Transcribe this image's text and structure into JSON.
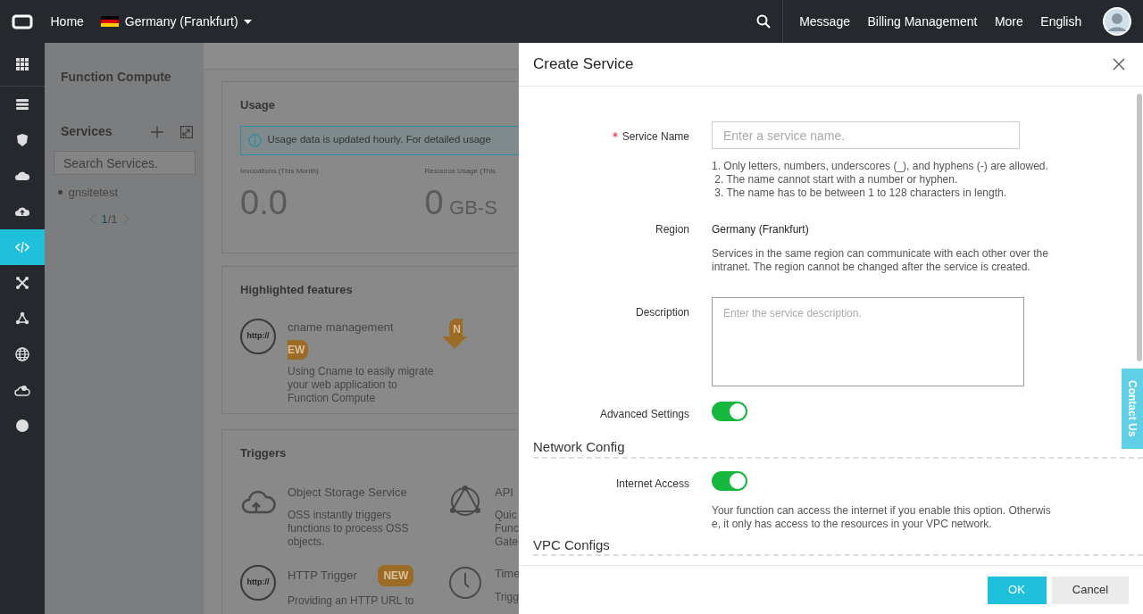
{
  "topbar": {
    "home": "Home",
    "region": "Germany (Frankfurt)",
    "links": [
      "Message",
      "Billing Management",
      "More",
      "English"
    ]
  },
  "rail": [
    {
      "selected": false
    },
    {
      "selected": false
    },
    {
      "selected": false
    },
    {
      "selected": false
    },
    {
      "selected": false
    },
    {
      "selected": true
    },
    {
      "selected": false
    },
    {
      "selected": false
    },
    {
      "selected": false
    },
    {
      "selected": false
    },
    {
      "selected": false
    }
  ],
  "sidebar": {
    "title": "Function Compute",
    "services_heading": "Services",
    "search": {
      "placeholder": "Search Services."
    },
    "services": [
      "gnsitetest"
    ],
    "pager": {
      "current": "1",
      "total": "/1"
    }
  },
  "usage": {
    "title": "Usage",
    "notice": "Usage data is updated hourly. For detailed usage",
    "metrics": [
      {
        "label": "Invocations (This Month)",
        "value": "0.0"
      },
      {
        "label": "Resource Usage (This",
        "value": "0",
        "unit": "GB-S"
      }
    ]
  },
  "highlighted": {
    "title": "Highlighted features",
    "items": [
      {
        "title": "cname management",
        "badge": "N",
        "badge_wrap": "EW",
        "icon_text": "http://",
        "description": "Using Cname to easily migrate your web application to Function Compute"
      }
    ]
  },
  "triggers": {
    "title": "Triggers",
    "items": [
      {
        "kind": "cloud",
        "title": "Object Storage Service",
        "lines": [
          "OSS instantly triggers",
          "functions to process OSS",
          "objects."
        ]
      },
      {
        "kind": "network",
        "title": "API",
        "lines": [
          "Quic",
          "Func",
          "Gate"
        ]
      },
      {
        "kind": "http",
        "icon_text": "http://",
        "title": "HTTP Trigger",
        "badge": "NEW",
        "lines": [
          "Providing an HTTP URL to"
        ]
      },
      {
        "kind": "clock",
        "title": "Time",
        "lines": [
          "Trigg"
        ]
      }
    ]
  },
  "drawer": {
    "title": "Create Service",
    "fields": [
      {
        "kind": "input",
        "label": "Service Name",
        "required": true,
        "placeholder": "Enter a service name.",
        "help": [
          "1. Only letters, numbers, underscores (_), and hyphens (-) are allowed.",
          " 2. The name cannot start with a number or hyphen.",
          " 3. The name has to be between 1 to 128 characters in length."
        ]
      },
      {
        "kind": "static",
        "label": "Region",
        "value": "Germany (Frankfurt)",
        "help": [
          "Services in the same region can communicate with each other over the",
          "intranet. The region cannot be changed after the service is created."
        ]
      },
      {
        "kind": "textarea",
        "label": "Description",
        "placeholder": "Enter the service description."
      },
      {
        "kind": "switch",
        "label": "Advanced Settings",
        "on": true
      },
      {
        "kind": "section",
        "label": "Network Config"
      },
      {
        "kind": "switch",
        "label": "Internet Access",
        "on": true,
        "help": [
          "Your function can access the internet if you enable this option. Otherwis",
          "e, it only has access to the resources in your VPC network."
        ]
      },
      {
        "kind": "section",
        "label": "VPC Configs"
      }
    ],
    "buttons": [
      {
        "kind": "primary",
        "label": "OK"
      },
      {
        "kind": "secondary",
        "label": "Cancel"
      }
    ]
  },
  "contact_tab": "Contact Us"
}
